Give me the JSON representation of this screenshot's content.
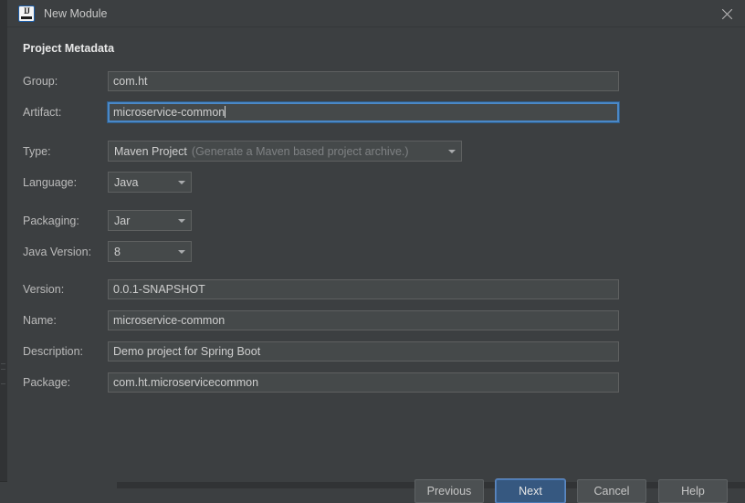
{
  "window": {
    "title": "New Module",
    "app_icon": "intellij-idea-icon",
    "close_icon": "close-icon",
    "background_color": "#3c3f41"
  },
  "dialog": {
    "section_heading": "Project Metadata",
    "accent_color": "#365880",
    "focus_border_color": "#4a88c7"
  },
  "fields": {
    "group": {
      "label": "Group:",
      "value": "com.ht"
    },
    "artifact": {
      "label": "Artifact:",
      "value": "microservice-common",
      "focused": true
    },
    "type": {
      "label": "Type:",
      "value": "Maven Project",
      "hint": "(Generate a Maven based project archive.)",
      "arrow_icon": "chevron-down-icon"
    },
    "language": {
      "label": "Language:",
      "value": "Java",
      "arrow_icon": "chevron-down-icon"
    },
    "packaging": {
      "label": "Packaging:",
      "value": "Jar",
      "arrow_icon": "chevron-down-icon"
    },
    "java_version": {
      "label": "Java Version:",
      "value": "8",
      "arrow_icon": "chevron-down-icon"
    },
    "version": {
      "label": "Version:",
      "value": "0.0.1-SNAPSHOT"
    },
    "name": {
      "label": "Name:",
      "value": "microservice-common"
    },
    "description": {
      "label": "Description:",
      "value": "Demo project for Spring Boot"
    },
    "package": {
      "label": "Package:",
      "value": "com.ht.microservicecommon"
    }
  },
  "buttons": {
    "previous": "Previous",
    "next": "Next",
    "cancel": "Cancel",
    "help": "Help"
  }
}
